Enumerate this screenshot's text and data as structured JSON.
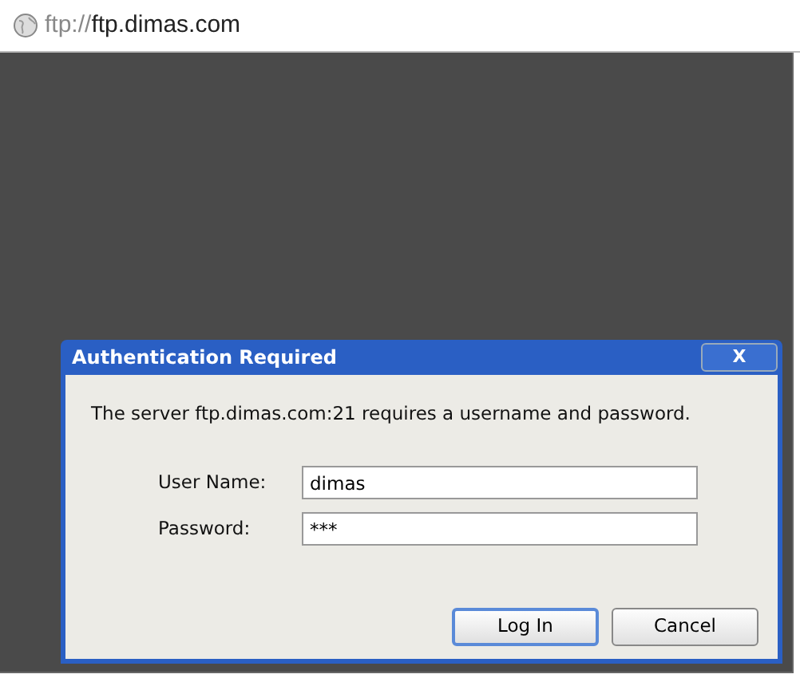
{
  "address_bar": {
    "scheme": "ftp://",
    "host": "ftp.dimas.com"
  },
  "dialog": {
    "title": "Authentication Required",
    "close": "X",
    "message": "The server ftp.dimas.com:21 requires a username and password.",
    "fields": [
      {
        "label": "User Name:",
        "value": "dimas"
      },
      {
        "label": "Password:",
        "value": "***"
      }
    ],
    "buttons": [
      {
        "label": "Log In",
        "default": true
      },
      {
        "label": "Cancel",
        "default": false
      }
    ]
  }
}
